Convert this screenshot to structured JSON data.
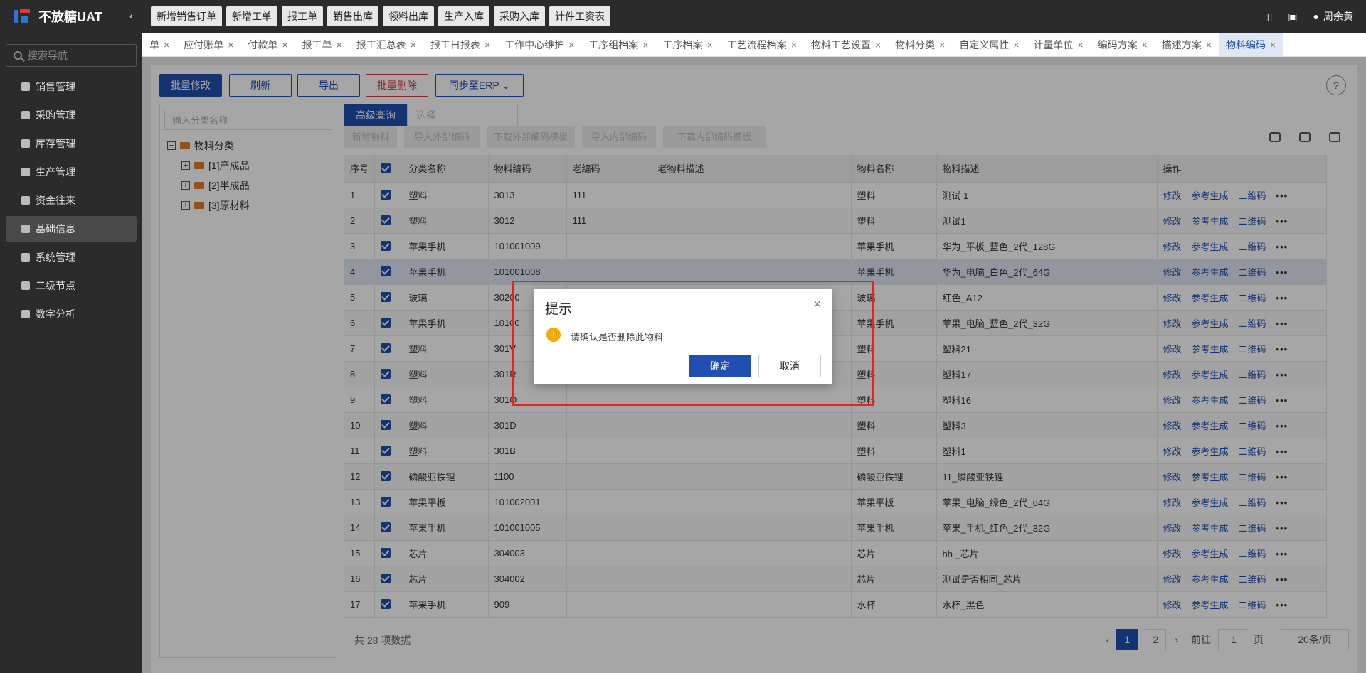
{
  "app": {
    "name": "不放糖UAT"
  },
  "sidebar": {
    "search_placeholder": "搜索导航",
    "items": [
      {
        "label": "销售管理"
      },
      {
        "label": "采购管理"
      },
      {
        "label": "库存管理"
      },
      {
        "label": "生产管理"
      },
      {
        "label": "资金往来"
      },
      {
        "label": "基础信息"
      },
      {
        "label": "系统管理"
      },
      {
        "label": "二级节点"
      },
      {
        "label": "数字分析"
      }
    ]
  },
  "topbar": {
    "quick": [
      "新增销售订单",
      "新增工单",
      "报工单",
      "销售出库",
      "领料出库",
      "生产入库",
      "采购入库",
      "计件工资表"
    ],
    "user": "周余黄"
  },
  "tabs": [
    "单",
    "应付账单",
    "付款单",
    "报工单",
    "报工汇总表",
    "报工日报表",
    "工作中心维护",
    "工序组档案",
    "工序档案",
    "工艺流程档案",
    "物料工艺设置",
    "物料分类",
    "自定义属性",
    "计量单位",
    "编码方案",
    "描述方案",
    "物料编码"
  ],
  "toolbar": {
    "batch_edit": "批量修改",
    "refresh": "刷新",
    "export": "导出",
    "batch_delete": "批量删除",
    "sync": "同步至ERP ⌄",
    "help": "?"
  },
  "tree": {
    "search_placeholder": "输入分类名称",
    "root": "物料分类",
    "children": [
      "[1]产成品",
      "[2]半成品",
      "[3]原材料"
    ]
  },
  "filter": {
    "advanced": "高级查询",
    "select_placeholder": "选择",
    "disabled_buttons": [
      "新增物料",
      "导入外部编码",
      "下载外部编码模板",
      "导入内部编码",
      "下载内部编码模板"
    ]
  },
  "table": {
    "headers": [
      "序号",
      "",
      "分类名称",
      "物料编码",
      "老编码",
      "老物料描述",
      "物料名称",
      "物料描述",
      "",
      "操作"
    ],
    "rows": [
      {
        "no": "1",
        "cat": "塑料",
        "code": "3013",
        "old": "111",
        "name": "塑料",
        "desc": "测试 1"
      },
      {
        "no": "2",
        "cat": "塑料",
        "code": "3012",
        "old": "111",
        "name": "塑料",
        "desc": "测试1"
      },
      {
        "no": "3",
        "cat": "苹果手机",
        "code": "101001009",
        "old": "",
        "name": "苹果手机",
        "desc": "华为_平板_蓝色_2代_128G"
      },
      {
        "no": "4",
        "cat": "苹果手机",
        "code": "101001008",
        "old": "",
        "name": "苹果手机",
        "desc": "华为_电脑_白色_2代_64G"
      },
      {
        "no": "5",
        "cat": "玻璃",
        "code": "30200",
        "old": "",
        "name": "玻璃",
        "desc": "红色_A12"
      },
      {
        "no": "6",
        "cat": "苹果手机",
        "code": "10100",
        "old": "",
        "name": "苹果手机",
        "desc": "苹果_电脑_蓝色_2代_32G"
      },
      {
        "no": "7",
        "cat": "塑料",
        "code": "301V",
        "old": "",
        "name": "塑料",
        "desc": "塑料21"
      },
      {
        "no": "8",
        "cat": "塑料",
        "code": "301R",
        "old": "",
        "name": "塑料",
        "desc": "塑料17"
      },
      {
        "no": "9",
        "cat": "塑料",
        "code": "301Q",
        "old": "",
        "name": "塑料",
        "desc": "塑料16"
      },
      {
        "no": "10",
        "cat": "塑料",
        "code": "301D",
        "old": "",
        "name": "塑料",
        "desc": "塑料3"
      },
      {
        "no": "11",
        "cat": "塑料",
        "code": "301B",
        "old": "",
        "name": "塑料",
        "desc": "塑料1"
      },
      {
        "no": "12",
        "cat": "磷酸亚铁锂",
        "code": "1100",
        "old": "",
        "name": "磷酸亚铁锂",
        "desc": "11_磷酸亚铁锂"
      },
      {
        "no": "13",
        "cat": "苹果平板",
        "code": "101002001",
        "old": "",
        "name": "苹果平板",
        "desc": "苹果_电脑_绿色_2代_64G"
      },
      {
        "no": "14",
        "cat": "苹果手机",
        "code": "101001005",
        "old": "",
        "name": "苹果手机",
        "desc": "苹果_手机_红色_2代_32G"
      },
      {
        "no": "15",
        "cat": "芯片",
        "code": "304003",
        "old": "",
        "name": "芯片",
        "desc": "hh _芯片"
      },
      {
        "no": "16",
        "cat": "芯片",
        "code": "304002",
        "old": "",
        "name": "芯片",
        "desc": "测试是否相同_芯片"
      },
      {
        "no": "17",
        "cat": "苹果手机",
        "code": "909",
        "old": "",
        "name": "水杯",
        "desc": "水杯_黑色"
      }
    ],
    "ops": {
      "edit": "修改",
      "ref": "参考生成",
      "qr": "二维码",
      "more": "•••"
    }
  },
  "footer": {
    "total": "共 28 项数据",
    "pages": [
      "1",
      "2"
    ],
    "goto": "前往",
    "goto_value": "1",
    "page_unit": "页",
    "page_size": "20条/页"
  },
  "dialog": {
    "title": "提示",
    "message": "请确认是否删除此物料",
    "ok": "确定",
    "cancel": "取消",
    "close": "×"
  },
  "colors": {
    "primary": "#1f4fb0",
    "danger": "#d9363e",
    "warning": "#f4a800",
    "highlight": "#e8231b"
  }
}
